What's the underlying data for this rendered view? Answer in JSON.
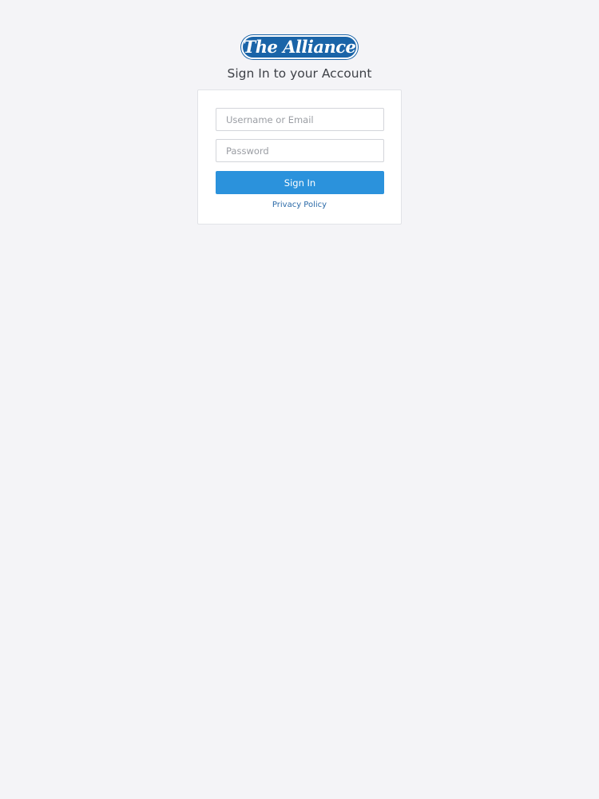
{
  "logo": {
    "text": "The Alliance",
    "bg_color": "#1a64a8"
  },
  "page_title": "Sign In to your Account",
  "form": {
    "username": {
      "value": "",
      "placeholder": "Username or Email"
    },
    "password": {
      "value": "",
      "placeholder": "Password"
    },
    "signin_label": "Sign In",
    "privacy_label": "Privacy Policy"
  },
  "colors": {
    "background": "#f4f4f7",
    "accent": "#2b92dc",
    "link": "#2b6aa8"
  }
}
